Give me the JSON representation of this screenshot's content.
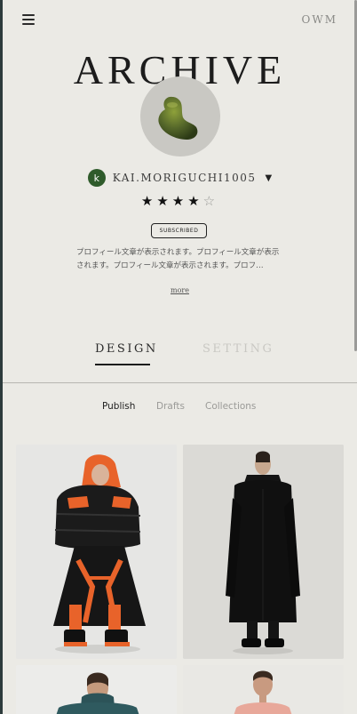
{
  "header": {
    "brand": "OWM",
    "menu_icon": "hamburger-menu-icon"
  },
  "profile": {
    "title": "ARCHIVE",
    "avatar_icon": "green-blob-sculpture-avatar",
    "user_initial": "k",
    "username": "KAI.MORIGUCHI1005",
    "dropdown_icon": "chevron-down-icon",
    "rating": {
      "value": 4,
      "max": 5
    },
    "badge": "SUBSCRIBED",
    "bio": "プロフィール文章が表示されます。プロフィール文章が表示されます。プロフィール文章が表示されます。プロフ…",
    "more_label": "more"
  },
  "tabs": [
    {
      "label": "DESIGN",
      "active": true
    },
    {
      "label": "SETTING",
      "active": false
    }
  ],
  "subtabs": [
    {
      "label": "Publish",
      "active": true
    },
    {
      "label": "Drafts",
      "active": false
    },
    {
      "label": "Collections",
      "active": false
    }
  ],
  "gallery": [
    {
      "name": "black-orange-puffer-look"
    },
    {
      "name": "black-long-coat-look"
    },
    {
      "name": "teal-knit-look"
    },
    {
      "name": "pink-top-look"
    }
  ],
  "colors": {
    "background": "#ebeae5",
    "avatar_initial_bg": "#2f5b2b",
    "accent": "#1c1c1c"
  }
}
